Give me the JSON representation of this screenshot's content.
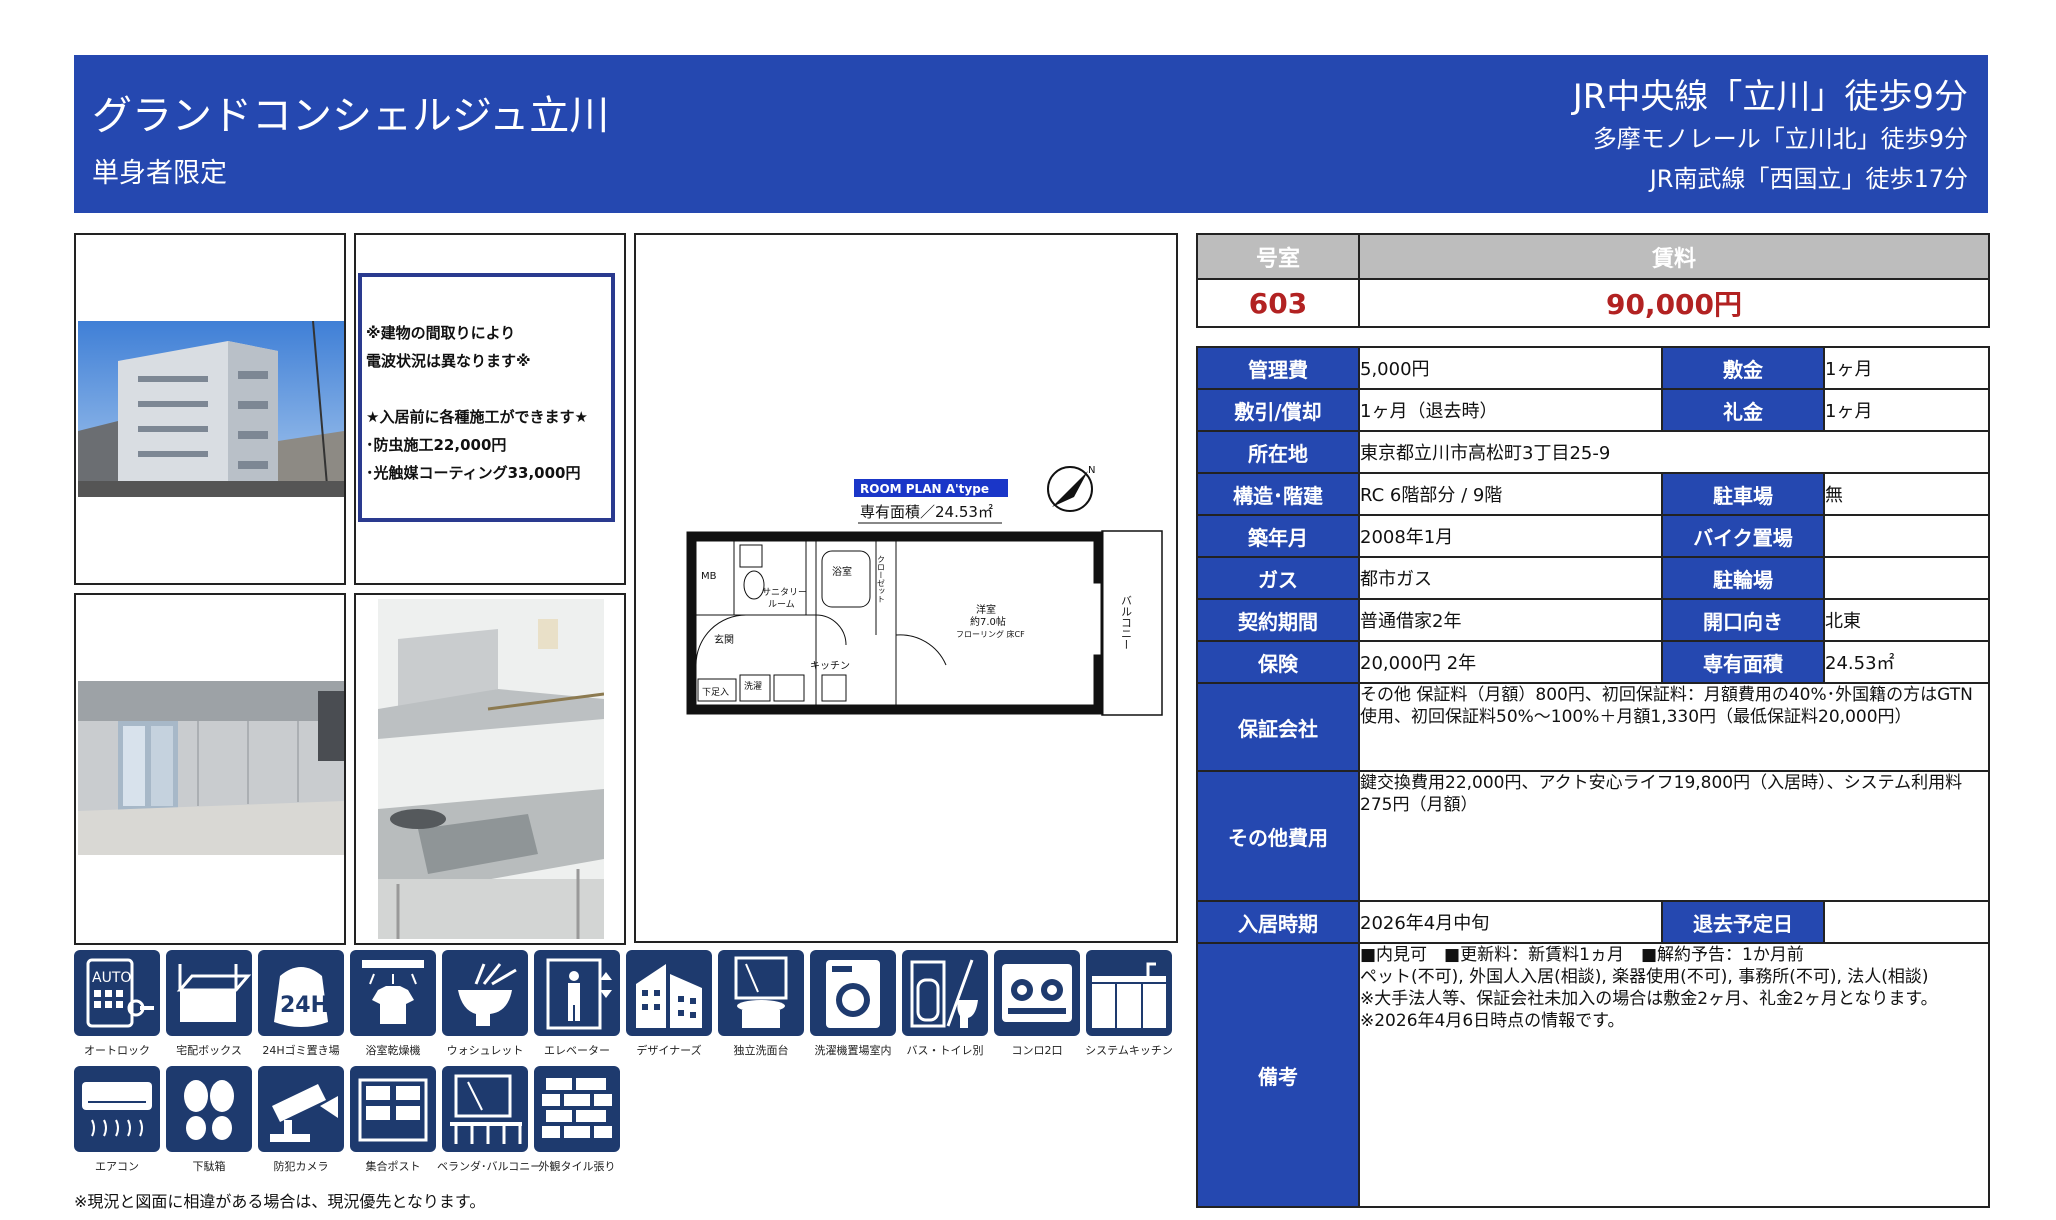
{
  "header": {
    "name": "グランドコンシェルジュ立川",
    "sub": "単身者限定",
    "stations": [
      "JR中央線「立川」徒歩9分",
      "多摩モノレール「立川北」徒歩9分",
      "JR南武線「西国立」徒歩17分"
    ]
  },
  "notice": {
    "lines": [
      "※建物の間取りにより",
      "電波状況は異なります※",
      "",
      "★入居前に各種施工ができます★",
      "･防虫施工22,000円",
      "･光触媒コーティング33,000円"
    ]
  },
  "floorplan": {
    "badge": "ROOM PLAN A'type",
    "area": "専有面積／24.53㎡",
    "rooms": {
      "mb": "MB",
      "sanitary": "サニタリー",
      "sanitary2": "ルーム",
      "bath": "浴室",
      "closet": "クローゼット",
      "western": "洋室",
      "western_size": "約7.0帖",
      "flooring": "フローリング 床CF",
      "balcony": "バルコニー",
      "entrance": "玄関",
      "kitchen": "キッチン",
      "wash": "洗濯",
      "shoebox": "下足入"
    }
  },
  "top_table": {
    "room_label": "号室",
    "rent_label": "賃料",
    "room": "603",
    "rent": "90,000円"
  },
  "details": {
    "mgmt_label": "管理費",
    "mgmt": "5,000円",
    "deposit_label": "敷金",
    "deposit": "1ヶ月",
    "shikibiki_label": "敷引/償却",
    "shikibiki": "1ヶ月（退去時）",
    "key_label": "礼金",
    "key": "1ヶ月",
    "address_label": "所在地",
    "address": "東京都立川市高松町3丁目25-9",
    "structure_label": "構造･階建",
    "structure": "RC 6階部分 / 9階",
    "parking_label": "駐車場",
    "parking": "無",
    "built_label": "築年月",
    "built": "2008年1月",
    "bike_label": "バイク置場",
    "bike": "",
    "gas_label": "ガス",
    "gas": "都市ガス",
    "bicycle_label": "駐輪場",
    "bicycle": "",
    "contract_label": "契約期間",
    "contract": "普通借家2年",
    "direction_label": "開口向き",
    "direction": "北東",
    "insurance_label": "保険",
    "insurance": "20,000円 2年",
    "area_label": "専有面積",
    "area": "24.53㎡",
    "guarantor_label": "保証会社",
    "guarantor": "その他 保証料（月額）800円、初回保証料：月額費用の40%･外国籍の方はGTN使用、初回保証料50%〜100%＋月額1,330円（最低保証料20,000円）",
    "other_label": "その他費用",
    "other": "鍵交換費用22,000円、アクト安心ライフ19,800円（入居時）、システム利用料275円（月額）",
    "movein_label": "入居時期",
    "movein": "2026年4月中旬",
    "moveout_label": "退去予定日",
    "moveout": "",
    "remarks_label": "備考",
    "remarks": [
      "■内見可　■更新料：新賃料1ヵ月　■解約予告：1か月前",
      "ペット(不可), 外国人入居(相談), 楽器使用(不可), 事務所(不可), 法人(相談)",
      "※大手法人等、保証会社未加入の場合は敷金2ヶ月、礼金2ヶ月となります。",
      "※2026年4月6日時点の情報です。"
    ]
  },
  "icons": [
    {
      "name": "autolock-icon",
      "label": "オートロック"
    },
    {
      "name": "delivery-box-icon",
      "label": "宅配ボックス"
    },
    {
      "name": "garbage-24h-icon",
      "label": "24Hゴミ置き場"
    },
    {
      "name": "bathroom-dryer-icon",
      "label": "浴室乾燥機"
    },
    {
      "name": "washlet-icon",
      "label": "ウォシュレット"
    },
    {
      "name": "elevator-icon",
      "label": "エレベーター"
    },
    {
      "name": "designers-icon",
      "label": "デザイナーズ"
    },
    {
      "name": "vanity-icon",
      "label": "独立洗面台"
    },
    {
      "name": "washer-space-icon",
      "label": "洗濯機置場室内"
    },
    {
      "name": "separate-bath-toilet-icon",
      "label": "バス・トイレ別"
    },
    {
      "name": "stove-2-icon",
      "label": "コンロ2口"
    },
    {
      "name": "system-kitchen-icon",
      "label": "システムキッチン"
    },
    {
      "name": "air-conditioner-icon",
      "label": "エアコン"
    },
    {
      "name": "shoe-box-icon",
      "label": "下駄箱"
    },
    {
      "name": "security-camera-icon",
      "label": "防犯カメラ"
    },
    {
      "name": "mailbox-icon",
      "label": "集合ポスト"
    },
    {
      "name": "balcony-icon",
      "label": "ベランダ･バルコニー"
    },
    {
      "name": "tile-exterior-icon",
      "label": "外観タイル張り"
    }
  ],
  "footer": "※現況と図面に相違がある場合は、現況優先となります。",
  "colors": {
    "accent": "#2548b0",
    "rent": "#b22222",
    "icon_bg": "#1e3a6e"
  }
}
